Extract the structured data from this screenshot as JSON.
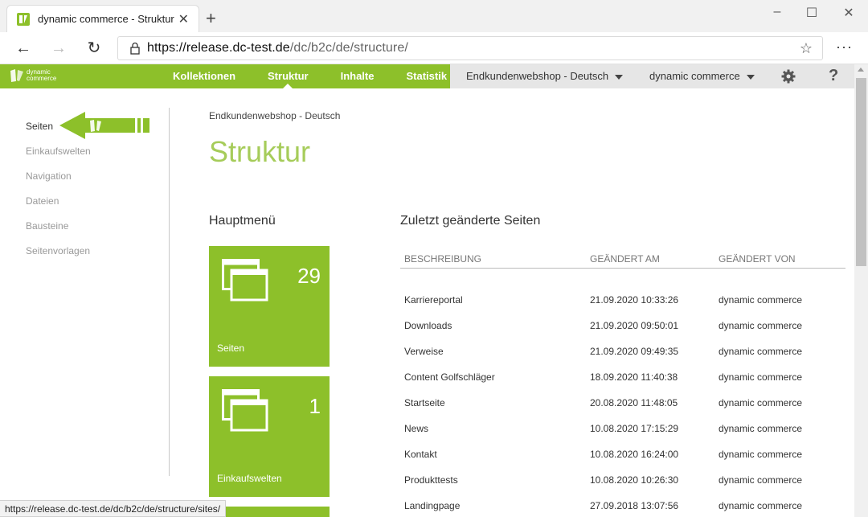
{
  "browser": {
    "tab_title": "dynamic commerce - Struktur",
    "new_tab_symbol": "+",
    "url_host": "https://release.dc-test.de",
    "url_path": "/dc/b2c/de/structure/",
    "status_url": "https://release.dc-test.de/dc/b2c/de/structure/sites/"
  },
  "app": {
    "logo_line1": "dynamic",
    "logo_line2": "commerce",
    "nav": [
      {
        "label": "Kollektionen"
      },
      {
        "label": "Struktur"
      },
      {
        "label": "Inhalte"
      },
      {
        "label": "Statistik"
      }
    ],
    "shop_select": "Endkundenwebshop - Deutsch",
    "user_select": "dynamic commerce",
    "help_symbol": "?"
  },
  "sidebar": {
    "items": [
      {
        "label": "Seiten"
      },
      {
        "label": "Einkaufswelten"
      },
      {
        "label": "Navigation"
      },
      {
        "label": "Dateien"
      },
      {
        "label": "Bausteine"
      },
      {
        "label": "Seitenvorlagen"
      }
    ]
  },
  "main": {
    "breadcrumb": "Endkundenwebshop - Deutsch",
    "title": "Struktur",
    "hauptmenu_heading": "Hauptmenü",
    "recent_heading": "Zuletzt geänderte Seiten",
    "tiles": [
      {
        "count": "29",
        "label": "Seiten"
      },
      {
        "count": "1",
        "label": "Einkaufswelten"
      }
    ],
    "table": {
      "headers": [
        "BESCHREIBUNG",
        "GEÄNDERT AM",
        "GEÄNDERT VON"
      ],
      "rows": [
        [
          "Karriereportal",
          "21.09.2020 10:33:26",
          "dynamic commerce"
        ],
        [
          "Downloads",
          "21.09.2020 09:50:01",
          "dynamic commerce"
        ],
        [
          "Verweise",
          "21.09.2020 09:49:35",
          "dynamic commerce"
        ],
        [
          "Content Golfschläger",
          "18.09.2020 11:40:38",
          "dynamic commerce"
        ],
        [
          "Startseite",
          "20.08.2020 11:48:05",
          "dynamic commerce"
        ],
        [
          "News",
          "10.08.2020 17:15:29",
          "dynamic commerce"
        ],
        [
          "Kontakt",
          "10.08.2020 16:24:00",
          "dynamic commerce"
        ],
        [
          "Produkttests",
          "10.08.2020 10:26:30",
          "dynamic commerce"
        ],
        [
          "Landingpage",
          "27.09.2018 13:07:56",
          "dynamic commerce"
        ]
      ]
    }
  },
  "colors": {
    "brand_green": "#8dc02a",
    "title_green": "#a6cc5a"
  }
}
